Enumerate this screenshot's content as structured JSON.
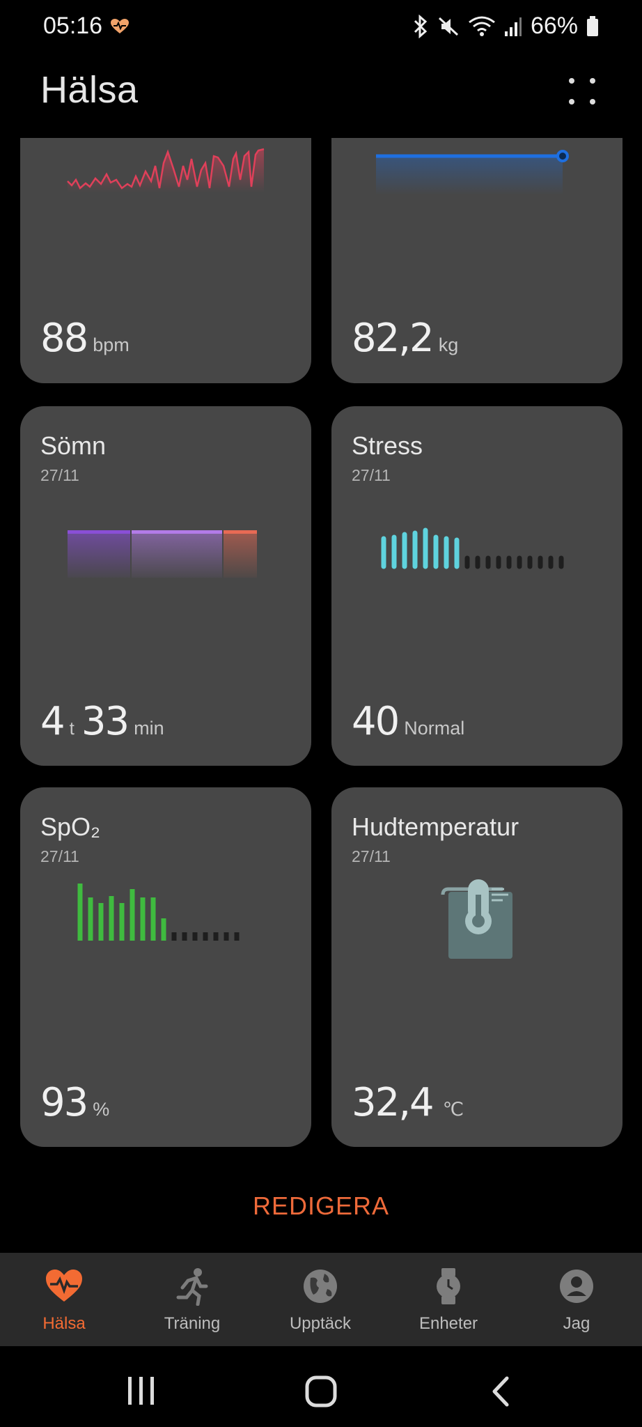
{
  "status_bar": {
    "time": "05:16",
    "battery": "66%",
    "icons": [
      "heart-status-icon",
      "bluetooth-icon",
      "mute-icon",
      "wifi-icon",
      "signal-icon",
      "battery-icon"
    ]
  },
  "header": {
    "title": "Hälsa"
  },
  "cards": {
    "heart_rate": {
      "value": "88",
      "unit": "bpm",
      "color": "#e0405a"
    },
    "weight": {
      "value": "82,2",
      "unit": "kg",
      "color": "#1e6fe0"
    },
    "sleep": {
      "title": "Sömn",
      "date": "27/11",
      "hours": "4",
      "hours_unit": "t",
      "minutes": "33",
      "minutes_unit": "min"
    },
    "stress": {
      "title": "Stress",
      "date": "27/11",
      "value": "40",
      "label": "Normal",
      "color": "#5fd3de"
    },
    "spo2": {
      "title": "SpO₂",
      "date": "27/11",
      "value": "93",
      "unit": "%",
      "color": "#3fbb3f"
    },
    "skin_temp": {
      "title": "Hudtemperatur",
      "date": "27/11",
      "value": "32,4",
      "unit": "℃"
    }
  },
  "edit_label": "REDIGERA",
  "bottom_nav": [
    {
      "label": "Hälsa",
      "icon": "heart-pulse-icon",
      "active": true
    },
    {
      "label": "Träning",
      "icon": "running-icon",
      "active": false
    },
    {
      "label": "Upptäck",
      "icon": "globe-icon",
      "active": false
    },
    {
      "label": "Enheter",
      "icon": "watch-icon",
      "active": false
    },
    {
      "label": "Jag",
      "icon": "profile-icon",
      "active": false
    }
  ],
  "accent_color": "#f36b33"
}
